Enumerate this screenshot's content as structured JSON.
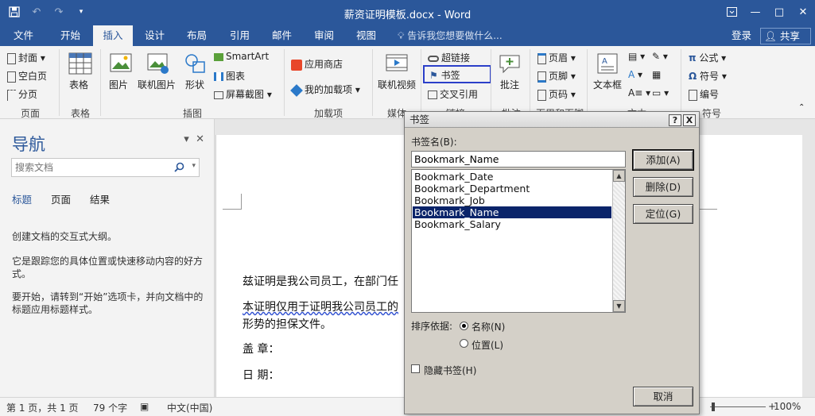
{
  "window": {
    "title": "薪资证明模板.docx - Word",
    "qat": [
      "save-icon",
      "undo-icon",
      "redo-icon",
      "customize-icon"
    ],
    "controls": [
      "ribbon-display-icon",
      "minimize-icon",
      "maximize-icon",
      "close-icon"
    ]
  },
  "ribbon": {
    "tabs": [
      "文件",
      "开始",
      "插入",
      "设计",
      "布局",
      "引用",
      "邮件",
      "审阅",
      "视图"
    ],
    "active_tab": "插入",
    "tell_me": "告诉我您想要做什么...",
    "login": "登录",
    "share": "共享",
    "groups": {
      "pages": {
        "label": "页面",
        "items": [
          "封面",
          "空白页",
          "分页"
        ]
      },
      "tables": {
        "label": "表格",
        "items": [
          "表格"
        ]
      },
      "illustrations": {
        "label": "插图",
        "items": [
          "图片",
          "联机图片",
          "形状",
          "SmartArt",
          "图表",
          "屏幕截图"
        ]
      },
      "addins": {
        "label": "加载项",
        "items": [
          "应用商店",
          "我的加载项"
        ]
      },
      "media": {
        "label": "媒体",
        "items": [
          "联机视频"
        ]
      },
      "links": {
        "label": "链接",
        "items": [
          "超链接",
          "书签",
          "交叉引用"
        ]
      },
      "comments": {
        "label": "批注",
        "items": [
          "批注"
        ]
      },
      "header_footer": {
        "label": "页眉和页脚",
        "items": [
          "页眉",
          "页脚",
          "页码"
        ]
      },
      "text": {
        "label": "文本",
        "items": [
          "文本框"
        ]
      },
      "symbols": {
        "label": "符号",
        "items": [
          "公式",
          "符号",
          "编号"
        ]
      }
    }
  },
  "nav": {
    "title": "导航",
    "search_placeholder": "搜索文档",
    "tabs": [
      "标题",
      "页面",
      "结果"
    ],
    "p1": "创建文档的交互式大纲。",
    "p2": "它是跟踪您的具体位置或快速移动内容的好方式。",
    "p3": "要开始，请转到“开始”选项卡，并向文档中的标题应用标题样式。"
  },
  "document": {
    "line1": "兹证明是我公司员工，在部门任",
    "line2": "本证明仅用于证明我公司员工的",
    "line3": "形势的担保文件。",
    "line4": "盖 章：",
    "line5": "日 期："
  },
  "dialog": {
    "title": "书签",
    "help": "?",
    "close": "X",
    "name_label": "书签名(B):",
    "name_value": "Bookmark_Name",
    "items": [
      "Bookmark_Date",
      "Bookmark_Department",
      "Bookmark_Job",
      "Bookmark_Name",
      "Bookmark_Salary"
    ],
    "selected_item": "Bookmark_Name",
    "add": "添加(A)",
    "delete": "删除(D)",
    "goto": "定位(G)",
    "sort_label": "排序依据:",
    "sort_name": "名称(N)",
    "sort_position": "位置(L)",
    "hidden": "隐藏书签(H)",
    "cancel": "取消"
  },
  "status": {
    "page": "第 1 页，共 1 页",
    "words": "79 个字",
    "lang": "中文(中国)",
    "zoom": "100%"
  },
  "colors": {
    "brand": "#2b579a",
    "highlight": "#2b3fc9",
    "selection": "#0a246a"
  }
}
